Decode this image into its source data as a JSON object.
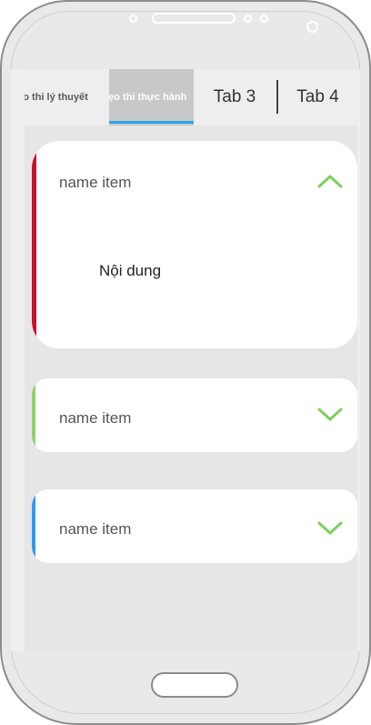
{
  "tabs": [
    {
      "label": "Mẹo thi lý thuyết"
    },
    {
      "label": "Mẹo thi thực hành"
    },
    {
      "label": "Tab 3"
    },
    {
      "label": "Tab 4"
    }
  ],
  "active_tab_index": 1,
  "colors": {
    "tab_indicator": "#2ea3e8",
    "expanded_accent": "#c8102e",
    "item2_accent": "#8dd36d",
    "item3_accent": "#2f9bf0",
    "chevron": "#7ccf5c"
  },
  "items": [
    {
      "title": "name item",
      "expanded": true,
      "content": "Nội dung",
      "chevron_icon": "chevron-up-icon"
    },
    {
      "title": "name item",
      "expanded": false,
      "chevron_icon": "chevron-down-icon"
    },
    {
      "title": "name item",
      "expanded": false,
      "chevron_icon": "chevron-down-icon"
    }
  ]
}
